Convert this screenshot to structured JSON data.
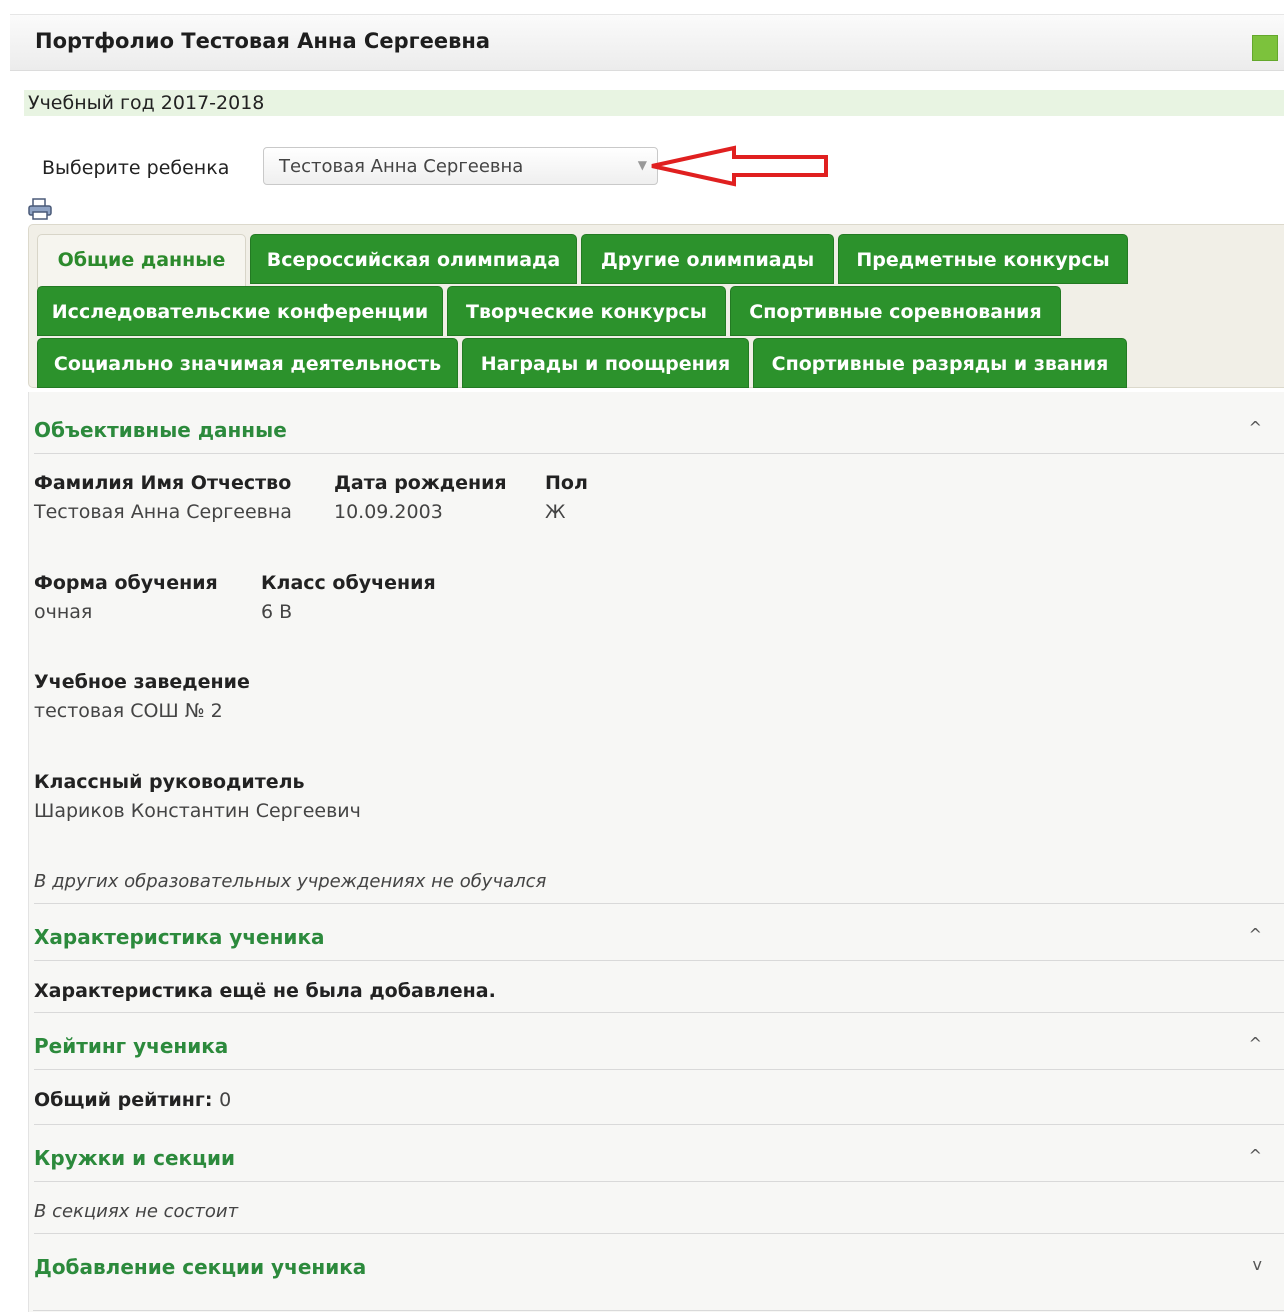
{
  "header": {
    "title": "Портфолио Тестовая Анна Сергеевна",
    "status_color": "#7cc23c"
  },
  "year": {
    "label": "Учебный год 2017-2018"
  },
  "child_picker": {
    "label": "Выберите ребенка",
    "selected": "Тестовая Анна Сергеевна"
  },
  "tabs": [
    {
      "label": "Общие данные",
      "active": true
    },
    {
      "label": "Всероссийская олимпиада",
      "active": false
    },
    {
      "label": "Другие олимпиады",
      "active": false
    },
    {
      "label": "Предметные конкурсы",
      "active": false
    },
    {
      "label": "Исследовательские конференции",
      "active": false
    },
    {
      "label": "Творческие конкурсы",
      "active": false
    },
    {
      "label": "Спортивные соревнования",
      "active": false
    },
    {
      "label": "Социально значимая деятельность",
      "active": false
    },
    {
      "label": "Награды и поощрения",
      "active": false
    },
    {
      "label": "Спортивные разряды и звания",
      "active": false
    }
  ],
  "objective": {
    "title": "Объективные данные",
    "fields": {
      "fio_label": "Фамилия Имя Отчество",
      "fio_value": "Тестовая Анна Сергеевна",
      "birth_label": "Дата рождения",
      "birth_value": "10.09.2003",
      "sex_label": "Пол",
      "sex_value": "Ж",
      "form_label": "Форма обучения",
      "form_value": "очная",
      "class_label": "Класс обучения",
      "class_value": "6 В",
      "school_label": "Учебное заведение",
      "school_value": "тестовая СОШ № 2",
      "teacher_label": "Классный руководитель",
      "teacher_value": "Шариков Константин Сергеевич"
    },
    "note": "В других образовательных учреждениях не обучался"
  },
  "characteristic": {
    "title": "Характеристика ученика",
    "text": "Характеристика ещё не была добавлена."
  },
  "rating": {
    "title": "Рейтинг ученика",
    "label": "Общий рейтинг:",
    "value": "0"
  },
  "clubs": {
    "title": "Кружки и секции",
    "note": "В секциях не состоит"
  },
  "add_section": {
    "title": "Добавление секции ученика"
  },
  "colors": {
    "accent_green": "#2c922c",
    "section_title": "#2c8a3c",
    "annotation_arrow": "#e02020"
  }
}
